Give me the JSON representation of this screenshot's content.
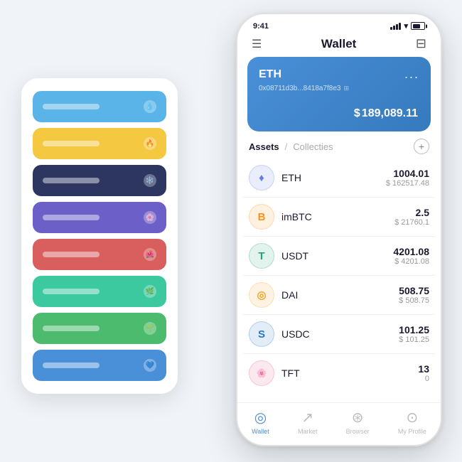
{
  "background_color": "#f0f4f8",
  "card_stack": {
    "cards": [
      {
        "id": "card-blue",
        "color": "#5ab4e8",
        "label": "",
        "icon": "💧"
      },
      {
        "id": "card-yellow",
        "color": "#f5c842",
        "label": "",
        "icon": "🔥"
      },
      {
        "id": "card-navy",
        "color": "#2d3561",
        "label": "",
        "icon": "❄️"
      },
      {
        "id": "card-purple",
        "color": "#6c5fc7",
        "label": "",
        "icon": "🌸"
      },
      {
        "id": "card-red",
        "color": "#d95f5f",
        "label": "",
        "icon": "🌺"
      },
      {
        "id": "card-teal",
        "color": "#3cc9a0",
        "label": "",
        "icon": "🌿"
      },
      {
        "id": "card-green",
        "color": "#4cbb6e",
        "label": "",
        "icon": "🌱"
      },
      {
        "id": "card-blue2",
        "color": "#4a90d9",
        "label": "",
        "icon": "💙"
      }
    ]
  },
  "phone": {
    "status_bar": {
      "time": "9:41",
      "signal": true,
      "wifi": true,
      "battery": true
    },
    "header": {
      "menu_icon": "☰",
      "title": "Wallet",
      "scan_icon": "⊟"
    },
    "eth_card": {
      "label": "ETH",
      "dots": "...",
      "address": "0x08711d3b...8418a7f8e3",
      "copy_icon": "⊞",
      "currency_symbol": "$",
      "balance": "189,089.11"
    },
    "assets_section": {
      "tab_active": "Assets",
      "separator": "/",
      "tab_inactive": "Collecties",
      "add_icon": "+"
    },
    "tokens": [
      {
        "name": "ETH",
        "icon_color": "#627eea",
        "icon_symbol": "♦",
        "balance": "1004.01",
        "usd": "$ 162517.48"
      },
      {
        "name": "imBTC",
        "icon_color": "#f7931a",
        "icon_symbol": "B",
        "balance": "2.5",
        "usd": "$ 21760.1"
      },
      {
        "name": "USDT",
        "icon_color": "#26a17b",
        "icon_symbol": "T",
        "balance": "4201.08",
        "usd": "$ 4201.08"
      },
      {
        "name": "DAI",
        "icon_color": "#f5a623",
        "icon_symbol": "◎",
        "balance": "508.75",
        "usd": "$ 508.75"
      },
      {
        "name": "USDC",
        "icon_color": "#2775ca",
        "icon_symbol": "S",
        "balance": "101.25",
        "usd": "$ 101.25"
      },
      {
        "name": "TFT",
        "icon_color": "#e85d8a",
        "icon_symbol": "🌸",
        "balance": "13",
        "usd": "0"
      }
    ],
    "bottom_nav": [
      {
        "id": "wallet",
        "icon": "◎",
        "label": "Wallet",
        "active": true
      },
      {
        "id": "market",
        "icon": "📈",
        "label": "Market",
        "active": false
      },
      {
        "id": "browser",
        "icon": "👤",
        "label": "Browser",
        "active": false
      },
      {
        "id": "profile",
        "icon": "👤",
        "label": "My Profile",
        "active": false
      }
    ]
  }
}
